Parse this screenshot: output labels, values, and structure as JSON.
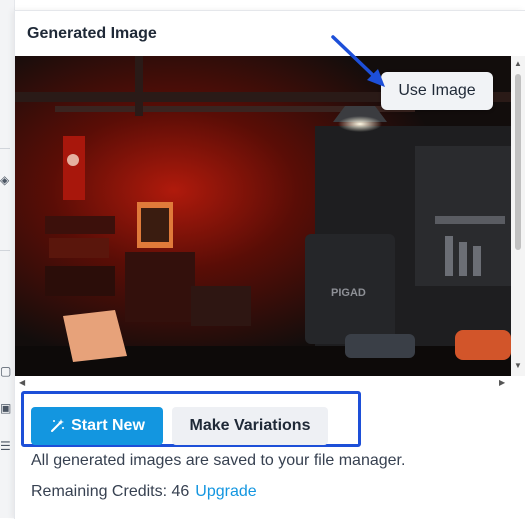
{
  "panel": {
    "title": "Generated Image"
  },
  "image": {
    "description_icon": "image-preview",
    "sign_text": "PIGAD"
  },
  "actions": {
    "use_image": "Use Image",
    "start_new": "Start New",
    "start_new_icon": "magic-wand-icon",
    "make_variations": "Make Variations"
  },
  "footer": {
    "info": "All generated images are saved to your file manager.",
    "credits_label": "Remaining Credits: 46",
    "upgrade_link": "Upgrade"
  },
  "colors": {
    "accent": "#1396e0",
    "annotation": "#1d4fd8"
  }
}
